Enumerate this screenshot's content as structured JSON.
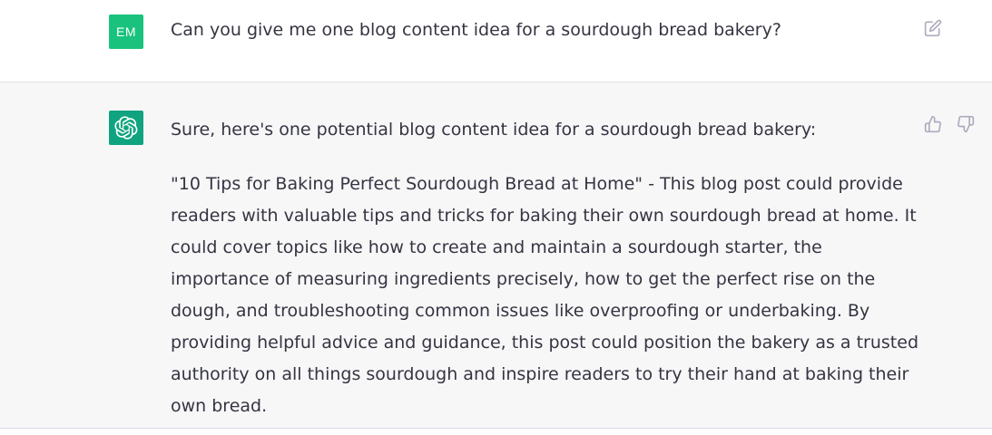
{
  "user_message": {
    "avatar_initials": "EM",
    "avatar_color": "#19c37d",
    "text": "Can you give me one blog content idea for a sourdough bread bakery?",
    "actions": {
      "edit_icon": "edit-icon"
    }
  },
  "assistant_message": {
    "avatar_icon": "openai-logo-icon",
    "avatar_color": "#10a37f",
    "paragraphs": [
      "Sure, here's one potential blog content idea for a sourdough bread bakery:",
      "\"10 Tips for Baking Perfect Sourdough Bread at Home\" - This blog post could provide readers with valuable tips and tricks for baking their own sourdough bread at home. It could cover topics like how to create and maintain a sourdough starter, the importance of measuring ingredients precisely, how to get the perfect rise on the dough, and troubleshooting common issues like overproofing or underbaking. By providing helpful advice and guidance, this post could position the bakery as a trusted authority on all things sourdough and inspire readers to try their hand at baking their own bread."
    ],
    "actions": {
      "like_icon": "thumbs-up-icon",
      "dislike_icon": "thumbs-down-icon"
    }
  }
}
